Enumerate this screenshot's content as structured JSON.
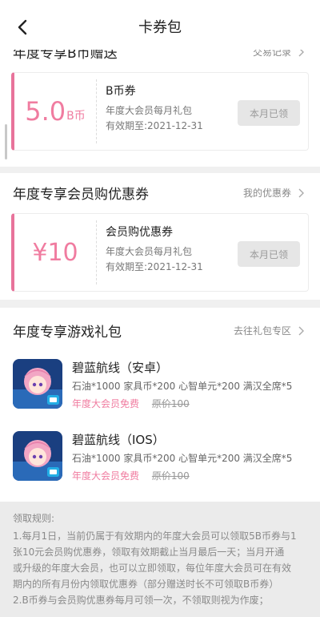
{
  "nav": {
    "title": "卡券包",
    "back_icon": "back-arrow-icon"
  },
  "bcoin": {
    "section_title": "年度专享B币赠送",
    "link": "交易记录",
    "amount": "5.0",
    "unit": "B币",
    "name": "B币券",
    "desc": "年度大会员每月礼包",
    "valid": "有效期至:2021-12-31",
    "button": "本月已领"
  },
  "member": {
    "section_title": "年度专享会员购优惠券",
    "link": "我的优惠券",
    "amount": "¥10",
    "name": "会员购优惠券",
    "desc": "年度大会员每月礼包",
    "valid": "有效期至:2021-12-31",
    "button": "本月已领"
  },
  "games": {
    "section_title": "年度专享游戏礼包",
    "link": "去往礼包专区",
    "items": [
      {
        "name": "碧蓝航线（安卓）",
        "items_text": "石油*1000 家具币*200 心智单元*200 满汉全席*5",
        "free": "年度大会员免费",
        "orig": "原价100"
      },
      {
        "name": "碧蓝航线（IOS）",
        "items_text": "石油*1000 家具币*200 心智单元*200 满汉全席*5",
        "free": "年度大会员免费",
        "orig": "原价100"
      }
    ]
  },
  "rules": {
    "title": "领取规则:",
    "lines": [
      "1.每月1日，当前仍属于有效期内的年度大会员可以领取5B币券与1",
      "张10元会员购优惠券，领取有效期截止当月最后一天；当月开通",
      "或升级的年度大会员，也可以立即领取，每位年度大会员可在有效",
      "期内的所有月份内领取优惠券（部分赠送时长不可领取B币券）",
      "2.B币券与会员购优惠券每月可领一次，不领取则视为作废；"
    ]
  },
  "colors": {
    "accent": "#f07ca0",
    "coupon_border": "#e8739b"
  }
}
